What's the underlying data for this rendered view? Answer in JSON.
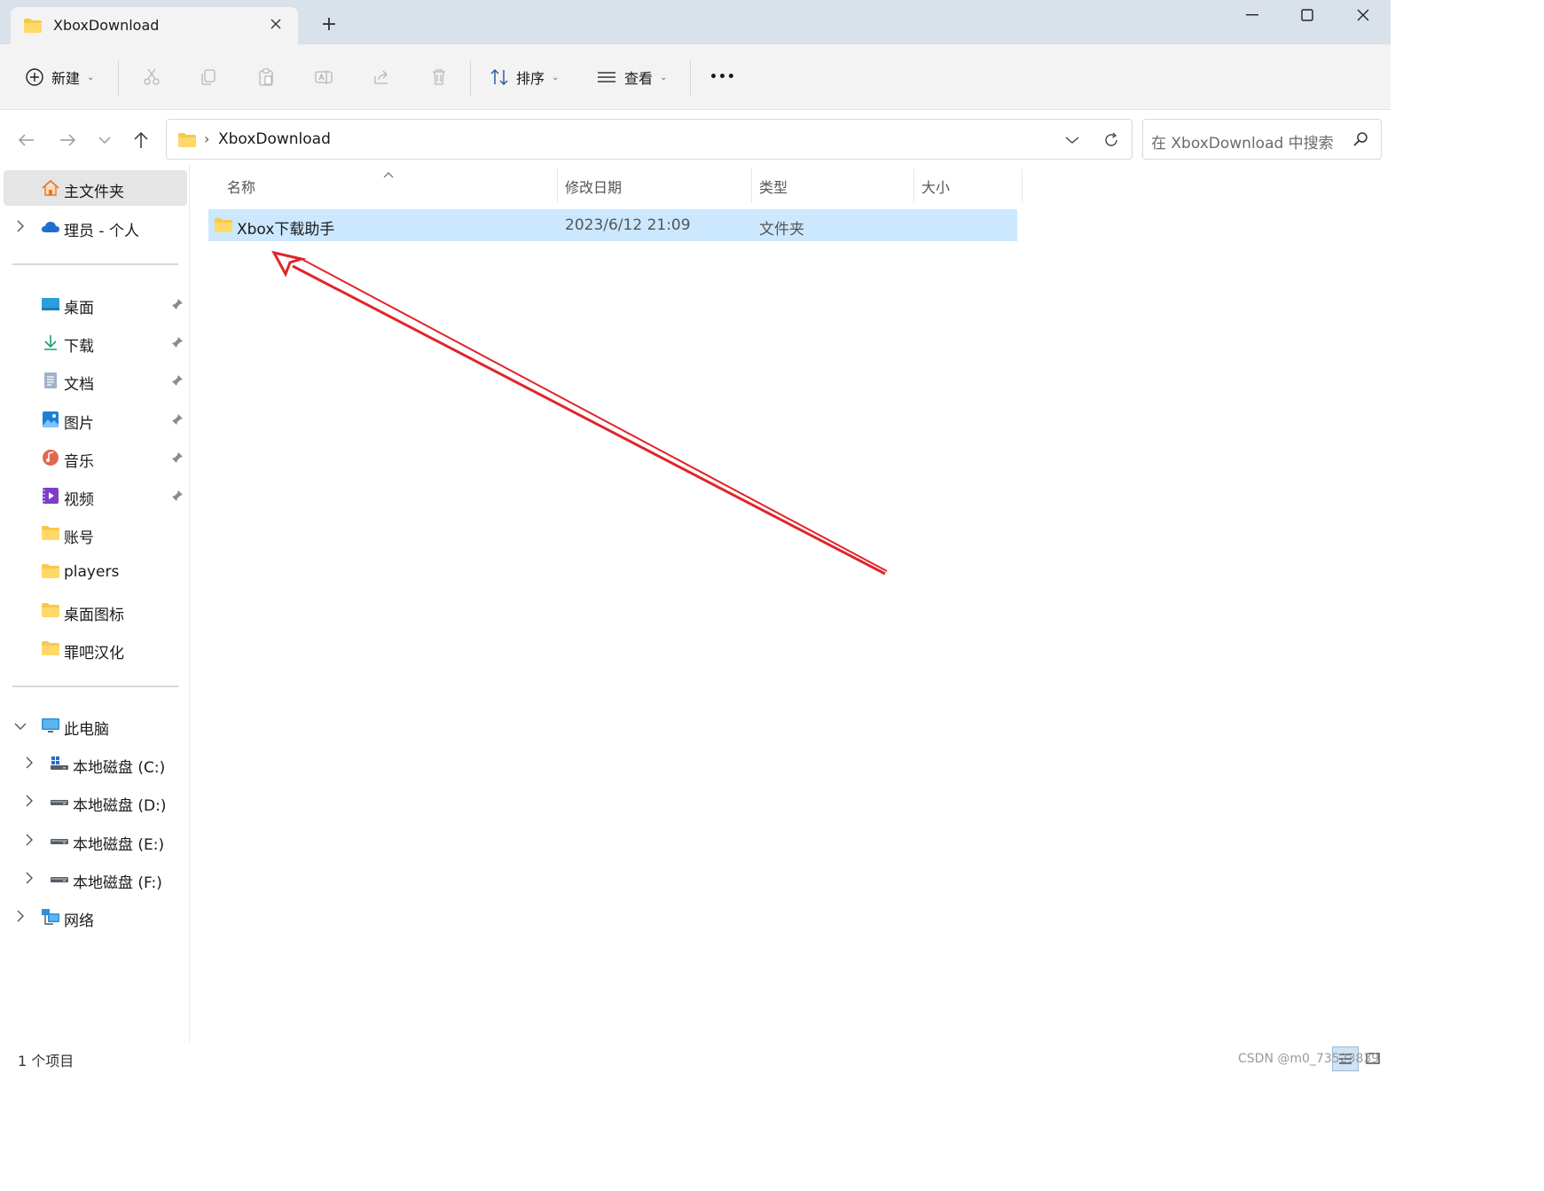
{
  "window": {
    "tab_title": "XboxDownload",
    "new_tab_label": "+"
  },
  "toolbar": {
    "new_label": "新建",
    "sort_label": "排序",
    "view_label": "查看",
    "more_label": "•••"
  },
  "address": {
    "path_separator": "›",
    "path": "XboxDownload"
  },
  "search": {
    "placeholder": "在 XboxDownload 中搜索"
  },
  "sidebar": {
    "home": "主文件夹",
    "onedrive": "理员 - 个人",
    "quick_access": [
      {
        "label": "桌面",
        "icon": "desktop-icon"
      },
      {
        "label": "下载",
        "icon": "download-icon"
      },
      {
        "label": "文档",
        "icon": "document-icon"
      },
      {
        "label": "图片",
        "icon": "picture-icon"
      },
      {
        "label": "音乐",
        "icon": "music-icon"
      },
      {
        "label": "视频",
        "icon": "video-icon"
      }
    ],
    "folders": [
      "账号",
      "players",
      "桌面图标",
      "罪吧汉化"
    ],
    "this_pc": "此电脑",
    "drives": [
      "本地磁盘 (C:)",
      "本地磁盘 (D:)",
      "本地磁盘 (E:)",
      "本地磁盘 (F:)"
    ],
    "network": "网络"
  },
  "columns": {
    "name": "名称",
    "modified": "修改日期",
    "type": "类型",
    "size": "大小"
  },
  "files": [
    {
      "name": "Xbox下载助手",
      "modified": "2023/6/12 21:09",
      "type": "文件夹",
      "size": ""
    }
  ],
  "status": {
    "count": "1 个项目"
  },
  "watermark": "CSDN @m0_73523839",
  "colors": {
    "selection": "#cce8ff",
    "titlebar": "#d9e1ea",
    "folder": "#f7c94b",
    "annotation_arrow": "#e0252b"
  }
}
